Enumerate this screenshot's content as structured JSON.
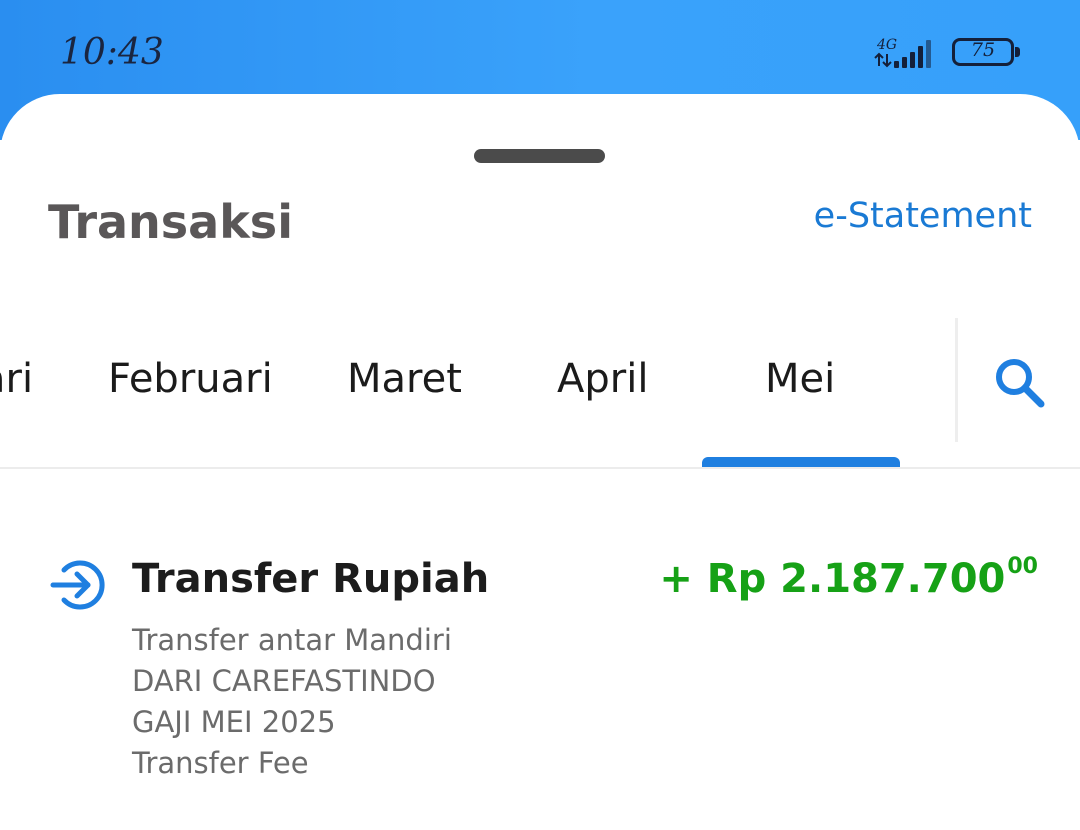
{
  "status_bar": {
    "time": "10:43",
    "network": "4G",
    "battery": "75"
  },
  "header": {
    "title": "Transaksi",
    "estatement_label": "e-Statement"
  },
  "tabs": {
    "items": [
      {
        "label": "Januari"
      },
      {
        "label": "Februari"
      },
      {
        "label": "Maret"
      },
      {
        "label": "April"
      },
      {
        "label": "Mei"
      }
    ],
    "selected": "Mei"
  },
  "search": {
    "icon": "search-icon"
  },
  "transactions": [
    {
      "icon": "transfer-in-icon",
      "title": "Transfer Rupiah",
      "amount": "+ Rp 2.187.700",
      "amount_cents": "00",
      "details": [
        "Transfer antar Mandiri",
        "DARI CAREFASTINDO",
        "GAJI MEI 2025",
        "Transfer Fee"
      ]
    }
  ],
  "colors": {
    "accent": "#1f7fe0",
    "link": "#1a7ad4",
    "credit": "#16a116",
    "header_bg": "#3aa2fb"
  }
}
